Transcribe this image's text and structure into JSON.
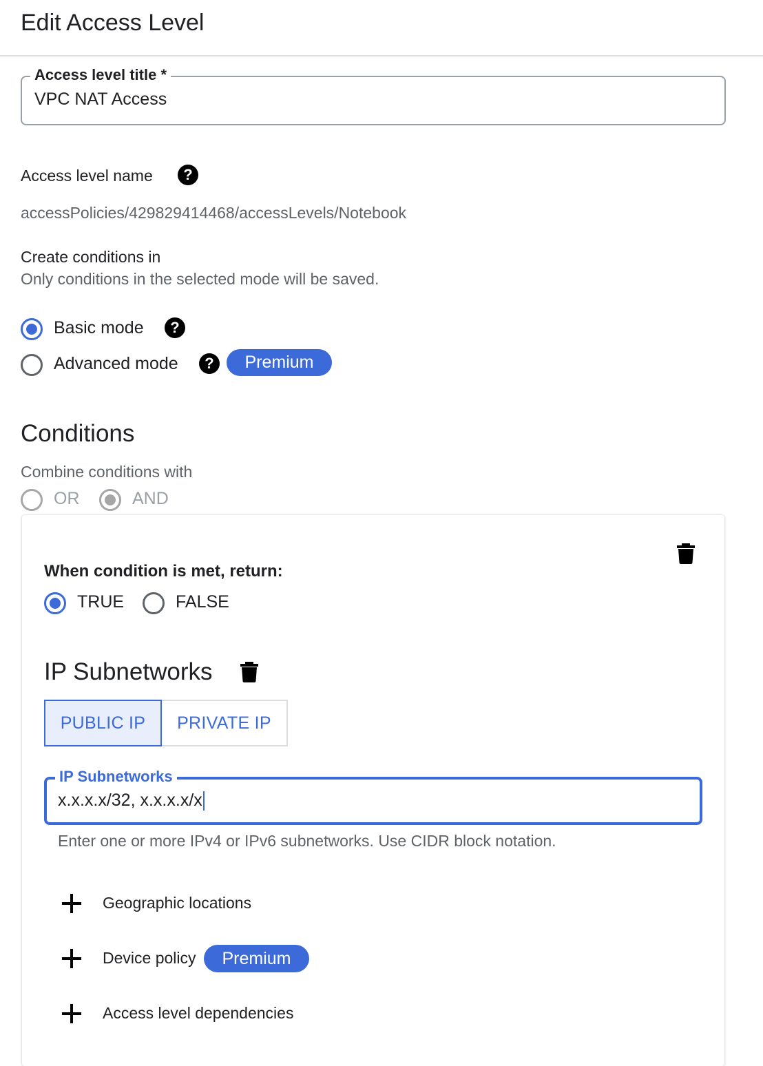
{
  "header": {
    "title": "Edit Access Level"
  },
  "title_field": {
    "label": "Access level title *",
    "value": "VPC NAT Access"
  },
  "access_level_name": {
    "label": "Access level name",
    "help_icon": "help-circle-icon",
    "value": "accessPolicies/429829414468/accessLevels/Notebook"
  },
  "create_conditions": {
    "heading": "Create conditions in",
    "subtext": "Only conditions in the selected mode will be saved.",
    "options": [
      {
        "label": "Basic mode",
        "selected": true
      },
      {
        "label": "Advanced mode",
        "selected": false,
        "badge": "Premium"
      }
    ]
  },
  "conditions": {
    "heading": "Conditions",
    "combine_label": "Combine conditions with",
    "combine_options": [
      {
        "label": "OR",
        "selected": false
      },
      {
        "label": "AND",
        "selected": true
      }
    ],
    "card": {
      "return_label": "When condition is met, return:",
      "return_options": [
        {
          "label": "TRUE",
          "selected": true
        },
        {
          "label": "FALSE",
          "selected": false
        }
      ],
      "ip_section": {
        "heading": "IP Subnetworks",
        "tabs": [
          {
            "label": "PUBLIC IP",
            "selected": true
          },
          {
            "label": "PRIVATE IP",
            "selected": false
          }
        ],
        "field_label": "IP Subnetworks",
        "field_value": "x.x.x.x/32, x.x.x.x/x",
        "hint": "Enter one or more IPv4 or IPv6 subnetworks. Use CIDR block notation."
      },
      "add_items": [
        {
          "label": "Geographic locations"
        },
        {
          "label": "Device policy",
          "badge": "Premium"
        },
        {
          "label": "Access level dependencies"
        }
      ]
    }
  },
  "colors": {
    "accent": "#3c6ad8",
    "selected_tab_bg": "#e8eefb",
    "muted_text": "#5f6368",
    "disabled": "#a6a6a6"
  }
}
